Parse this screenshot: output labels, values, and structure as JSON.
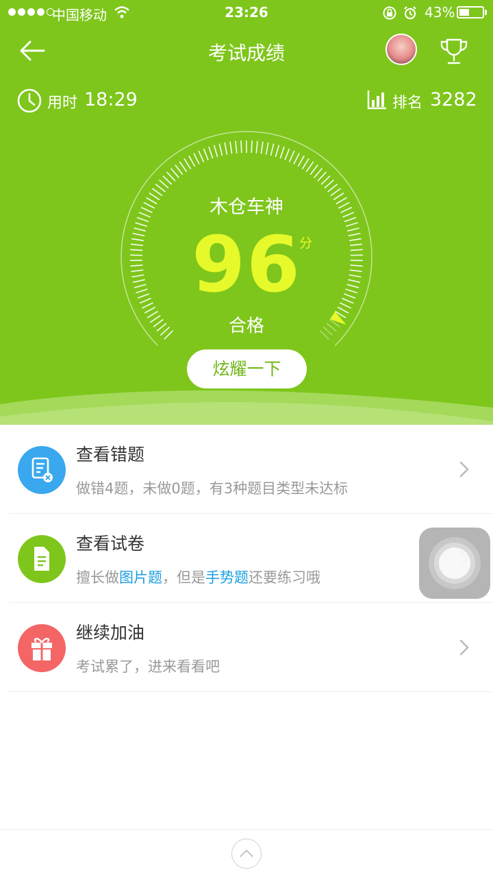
{
  "status_bar": {
    "carrier": "中国移动",
    "time": "23:26",
    "battery": "43%",
    "battery_level": 0.43
  },
  "nav": {
    "title": "考试成绩",
    "back_icon": "arrow-left-icon",
    "trophy_icon": "trophy-icon"
  },
  "stats": {
    "time_label": "用时",
    "time_value": "18:29",
    "rank_label": "排名",
    "rank_value": "3282"
  },
  "gauge": {
    "title": "木仓车神",
    "score": "96",
    "unit": "分",
    "status": "合格",
    "score_fraction": 0.96
  },
  "share_button": "炫耀一下",
  "list": [
    {
      "title": "查看错题",
      "subtitle": "做错4题，未做0题，有3种题目类型未达标",
      "icon": "wrong-questions-icon",
      "color": "#3aa8ee"
    },
    {
      "title": "查看试卷",
      "sub_pre": "擅长做",
      "sub_hl1": "图片题",
      "sub_mid": "，但是",
      "sub_hl2": "手势题",
      "sub_post": "还要练习哦",
      "icon": "document-icon",
      "color": "#7ec61b"
    },
    {
      "title": "继续加油",
      "subtitle": "考试累了，进来看看吧",
      "icon": "gift-icon",
      "color": "#f46566"
    }
  ],
  "colors": {
    "brand_green": "#7ec61b",
    "score_yellow": "#e6f92a",
    "highlight_blue": "#1a9fe0"
  }
}
